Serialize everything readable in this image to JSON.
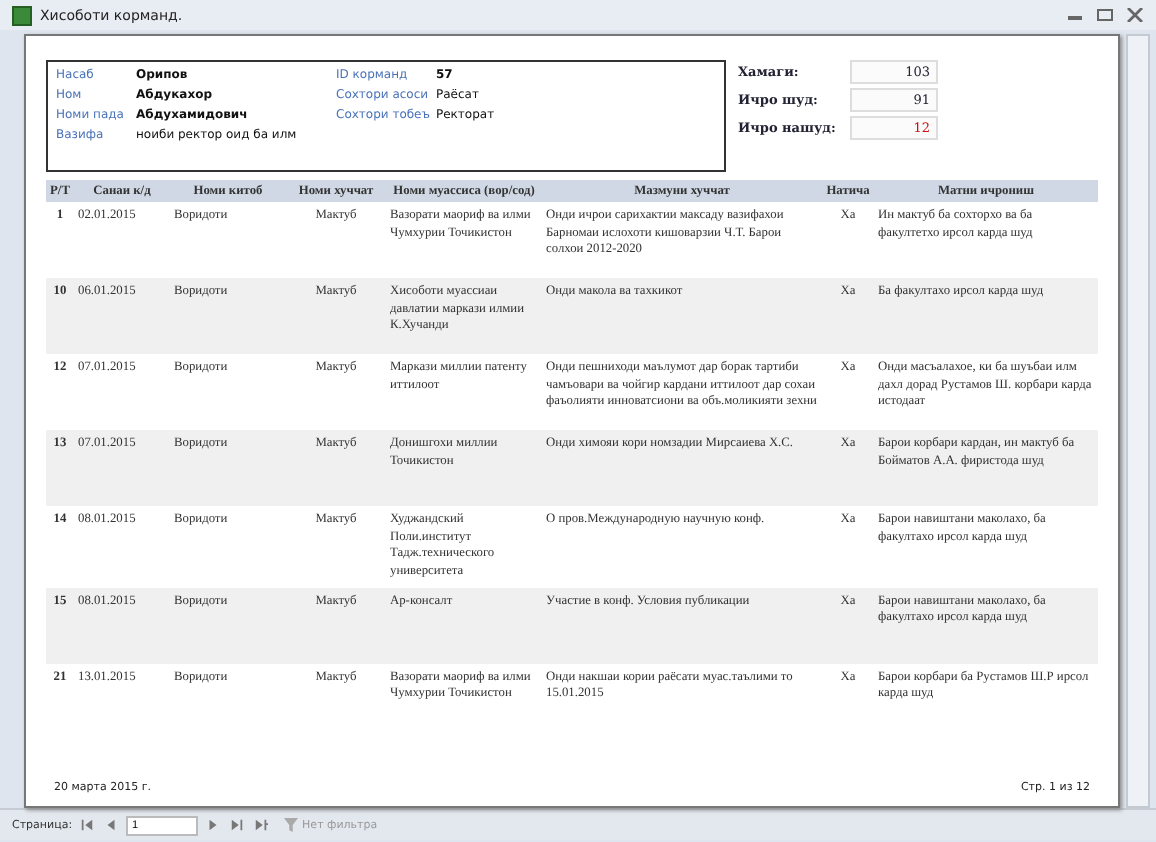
{
  "window": {
    "title": "Хисоботи корманд."
  },
  "employee": [
    {
      "label": "Насаб",
      "value": "Орипов",
      "bold": true
    },
    {
      "label": "Ном",
      "value": "Абдукахор",
      "bold": true
    },
    {
      "label": "Номи пада",
      "value": "Абдухамидович",
      "bold": true
    },
    {
      "label": "Вазифа",
      "value": "ноиби ректор оид ба илм",
      "bold": false
    }
  ],
  "employee_extra": [
    {
      "label": "ID корманд",
      "value": "57",
      "bold": true
    },
    {
      "label": "Сохтори асоси",
      "value": "Раёсат",
      "bold": false
    },
    {
      "label": "Сохтори тобеъ",
      "value": "Ректорат",
      "bold": false
    }
  ],
  "totals": [
    {
      "label": "Хамаги:",
      "value": "103",
      "alert": false
    },
    {
      "label": "Ичро шуд:",
      "value": "91",
      "alert": false
    },
    {
      "label": "Ичро нашуд:",
      "value": "12",
      "alert": true
    }
  ],
  "table": {
    "columns": [
      "Р/Т",
      "Санаи к/д",
      "Номи китоб",
      "Номи хуччат",
      "Номи муассиса (вор/сод)",
      "Мазмуни хуччат",
      "Натича",
      "Матни ичрониш"
    ],
    "rows": [
      [
        "1",
        "02.01.2015",
        "Воридоти",
        "Мактуб",
        "Вазорати маориф ва илми Чумхурии Точикистон",
        "Онди ичрои сарихактии максаду вазифахои Барномаи ислохоти кишоварзии Ч.Т. Барои солхои 2012-2020",
        "Ха",
        "Ин мактуб ба сохторхо ва ба факултетхо ирсол карда шуд"
      ],
      [
        "10",
        "06.01.2015",
        "Воридоти",
        "Мактуб",
        "Хисоботи муассиаи давлатии маркази илмии К.Хучанди",
        "Онди макола ва тахкикот",
        "Ха",
        "Ба факултахо ирсол карда шуд"
      ],
      [
        "12",
        "07.01.2015",
        "Воридоти",
        "Мактуб",
        "Маркази миллии патенту иттилоот",
        "Онди пешниходи маълумот дар борак тартиби чамъовари ва чойгир кардани иттилоот дар сохаи фаъолияти инноватсиони ва объ.моликияти зехни",
        "Ха",
        "Онди масъалахое, ки ба шуъбаи илм дахл дорад Рустамов Ш. корбари карда истодаат"
      ],
      [
        "13",
        "07.01.2015",
        "Воридоти",
        "Мактуб",
        "Донишгохи миллии Точикистон",
        "Онди химояи кори номзадии Мирсаиева Х.С.",
        "Ха",
        "Барои корбари кардан, ин мактуб ба Бойматов А.А. фиристода шуд"
      ],
      [
        "14",
        "08.01.2015",
        "Воридоти",
        "Мактуб",
        "Худжандский Поли.институт Тадж.технического университета",
        "О пров.Международную научную конф.",
        "Ха",
        "Барои навиштани маколахо, ба факултахо ирсол карда шуд"
      ],
      [
        "15",
        "08.01.2015",
        "Воридоти",
        "Мактуб",
        "Ар-консалт",
        "Участие в конф. Условия публикации",
        "Ха",
        "Барои навиштани маколахо, ба факултахо ирсол карда шуд"
      ],
      [
        "21",
        "13.01.2015",
        "Воридоти",
        "Мактуб",
        "Вазорати маориф ва илми Чумхурии Точикистон",
        "Онди накшаи кории раёсати муас.таълими то 15.01.2015",
        "Ха",
        "Барои корбари ба Рустамов Ш.Р ирсол карда шуд"
      ]
    ]
  },
  "footer": {
    "date": "20 марта 2015 г.",
    "page": "Стр. 1 из 12"
  },
  "navigation": {
    "label": "Страница:",
    "page": "1",
    "filter": "Нет фильтра"
  }
}
